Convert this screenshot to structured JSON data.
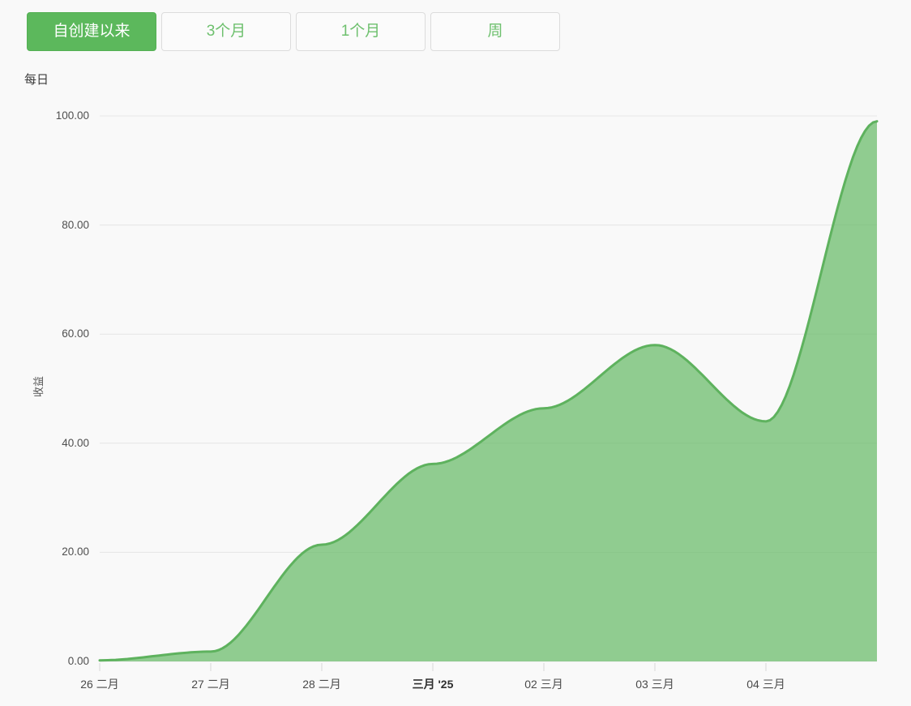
{
  "toolbar": {
    "buttons": [
      {
        "label": "自创建以来",
        "active": true
      },
      {
        "label": "3个月",
        "active": false
      },
      {
        "label": "1个月",
        "active": false
      },
      {
        "label": "周",
        "active": false
      }
    ]
  },
  "chart": {
    "frequency_label": "每日",
    "y_axis_title": "收益"
  },
  "colors": {
    "accent_green": "#5cb85c",
    "line": "#5eb25e",
    "fill": "rgba(94,183,94,0.68)",
    "gridline": "#e6e6e6",
    "tick": "#d6d6d6"
  },
  "chart_data": {
    "type": "area",
    "title": "",
    "xlabel": "",
    "ylabel": "收益",
    "frequency": "每日",
    "x_unit": "day",
    "xlim_days": [
      0,
      7
    ],
    "ylim": [
      0,
      100
    ],
    "grid": "horizontal",
    "legend": "none",
    "interpolation": "smooth-s-curve-flat-at-points",
    "y_ticks": [
      {
        "value": 0,
        "label": "0.00"
      },
      {
        "value": 20,
        "label": "20.00"
      },
      {
        "value": 40,
        "label": "40.00"
      },
      {
        "value": 60,
        "label": "60.00"
      },
      {
        "value": 80,
        "label": "80.00"
      },
      {
        "value": 100,
        "label": "100.00"
      }
    ],
    "x_ticks": [
      {
        "day": 0,
        "label": "26 二月",
        "bold": false
      },
      {
        "day": 1,
        "label": "27 二月",
        "bold": false
      },
      {
        "day": 2,
        "label": "28 二月",
        "bold": false
      },
      {
        "day": 3,
        "label": "三月 '25",
        "bold": true
      },
      {
        "day": 4,
        "label": "02 三月",
        "bold": false
      },
      {
        "day": 5,
        "label": "03 三月",
        "bold": false
      },
      {
        "day": 6,
        "label": "04 三月",
        "bold": false
      }
    ],
    "series": [
      {
        "name": "收益",
        "points": [
          {
            "day": 0,
            "value": 0.2
          },
          {
            "day": 1,
            "value": 1.8
          },
          {
            "day": 2,
            "value": 21.4
          },
          {
            "day": 3,
            "value": 36.2
          },
          {
            "day": 4,
            "value": 46.4
          },
          {
            "day": 5,
            "value": 58.0
          },
          {
            "day": 6,
            "value": 44.0
          },
          {
            "day": 7,
            "value": 99.0
          }
        ]
      }
    ]
  }
}
